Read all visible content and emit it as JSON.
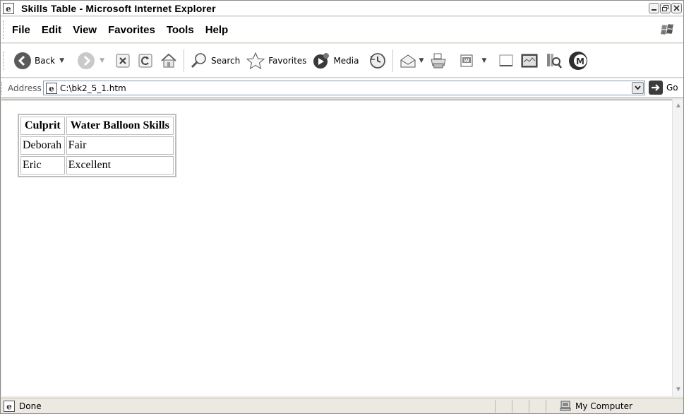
{
  "window": {
    "title": "Skills Table - Microsoft Internet Explorer"
  },
  "menu": [
    "File",
    "Edit",
    "View",
    "Favorites",
    "Tools",
    "Help"
  ],
  "toolbar": {
    "back_label": "Back",
    "search_label": "Search",
    "favorites_label": "Favorites",
    "media_label": "Media"
  },
  "address": {
    "label": "Address",
    "url": "C:\\bk2_5_1.htm",
    "go_label": "Go"
  },
  "table": {
    "headers": [
      "Culprit",
      "Water Balloon Skills"
    ],
    "rows": [
      [
        "Deborah",
        "Fair"
      ],
      [
        "Eric",
        "Excellent"
      ]
    ]
  },
  "status": {
    "text": "Done",
    "zone": "My Computer"
  }
}
